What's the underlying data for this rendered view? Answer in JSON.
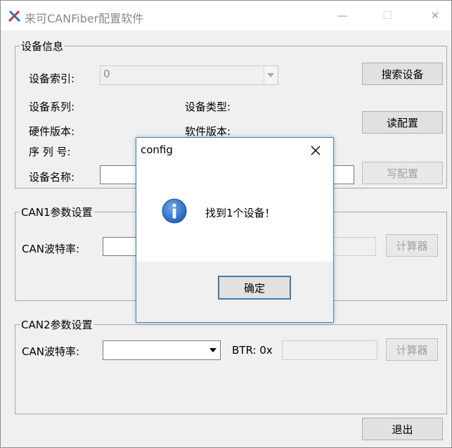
{
  "app": {
    "title": "来可CANFiber配置软件",
    "icon": "tools-icon",
    "window_controls": {
      "minimize": "—",
      "maximize": "☐",
      "close": "✕"
    }
  },
  "device_info": {
    "legend": "设备信息",
    "index_label": "设备索引:",
    "index_value": "0",
    "search_button": "搜索设备",
    "series_label": "设备系列:",
    "type_label": "设备类型:",
    "hw_version_label": "硬件版本:",
    "sw_version_label": "软件版本:",
    "read_config_button": "读配置",
    "serial_label": "序 列 号:",
    "name_label": "设备名称:",
    "write_config_button": "写配置"
  },
  "can1": {
    "legend": "CAN1参数设置",
    "baud_label": "CAN波特率:",
    "calc_button": "计算器"
  },
  "can2": {
    "legend": "CAN2参数设置",
    "baud_label": "CAN波特率:",
    "btr_label": "BTR: 0x",
    "calc_button": "计算器"
  },
  "exit_button": "退出",
  "dialog": {
    "title": "config",
    "close": "✕",
    "icon": "info-icon",
    "message": "找到1个设备！",
    "ok_button": "确定"
  },
  "colors": {
    "accent": "#3c82c8",
    "info_icon": "#2a6fc9",
    "disabled_text": "#a0a0a0"
  }
}
